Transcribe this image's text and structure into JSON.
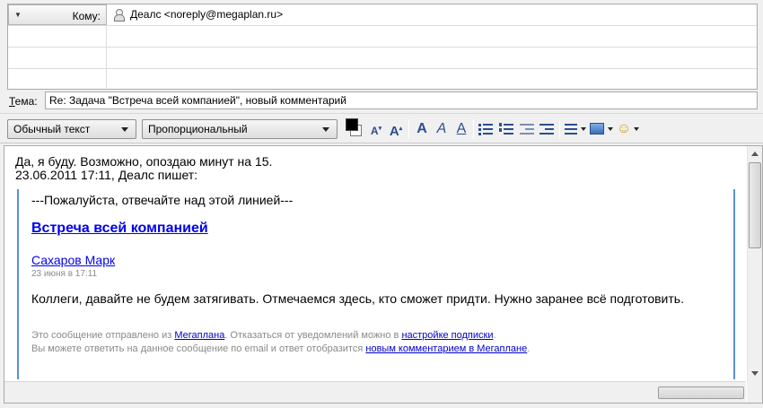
{
  "recipients": {
    "type_label": "Кому:",
    "first_address": "Деалс <noreply@megaplan.ru>"
  },
  "subject": {
    "label_accel": "Т",
    "label_rest": "ема:",
    "value": "Re: Задача \"Встреча всей компанией\", новый комментарий"
  },
  "toolbar": {
    "paragraph_style": "Обычный текст",
    "font_family": "Пропорциональный",
    "font_decrease": "A",
    "font_increase": "A",
    "bold": "A",
    "italic": "A",
    "underline": "A",
    "emoji": "☺"
  },
  "body": {
    "reply_line_1": "Да, я буду. Возможно, опоздаю минут на 15.",
    "reply_line_2": "23.06.2011 17:11, Деалс пишет:",
    "quote": {
      "divider": "---Пожалуйста, отвечайте над этой линией---",
      "task_link": "Встреча всей компанией",
      "author_link": "Сахаров Марк",
      "date": "23 июня в 17:11",
      "comment": "Коллеги, давайте не будем затягивать. Отмечаемся здесь, кто сможет придти. Нужно заранее всё подготовить.",
      "footer_1_pre": "Это сообщение отправлено из ",
      "footer_1_link1": "Мегаплана",
      "footer_1_mid": ". Отказаться от уведомлений можно в ",
      "footer_1_link2": "настройке подписки",
      "footer_1_end": ".",
      "footer_2_pre": "Вы можете ответить на данное сообщение по email и ответ отобразится ",
      "footer_2_link": "новым комментарием в Мегаплане",
      "footer_2_end": "."
    }
  },
  "colors": {
    "accent": "#2a4f8f",
    "link": "#0000ee",
    "quote_border": "#5b8fd1",
    "muted_text": "#8a8a8a"
  }
}
